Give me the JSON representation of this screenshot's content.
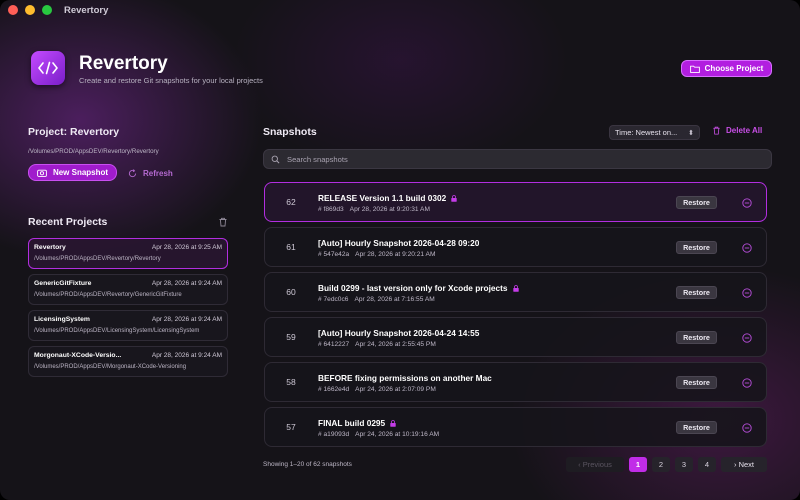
{
  "window": {
    "title": "Revertory"
  },
  "header": {
    "app_name": "Revertory",
    "subtitle": "Create and restore Git snapshots for your local projects",
    "choose_project_label": "Choose Project"
  },
  "project": {
    "title": "Project: Revertory",
    "path": "/Volumes/PROD/AppsDEV/Revertory/Revertory",
    "new_snapshot_label": "New Snapshot",
    "refresh_label": "Refresh"
  },
  "recent": {
    "title": "Recent Projects",
    "items": [
      {
        "name": "Revertory",
        "date": "Apr 28, 2026 at 9:25 AM",
        "path": "/Volumes/PROD/AppsDEV/Revertory/Revertory"
      },
      {
        "name": "GenericGitFixture",
        "date": "Apr 28, 2026 at 9:24 AM",
        "path": "/Volumes/PROD/AppsDEV/Revertory/GenericGitFixture"
      },
      {
        "name": "LicensingSystem",
        "date": "Apr 28, 2026 at 9:24 AM",
        "path": "/Volumes/PROD/AppsDEV/LicensingSystem/LicensingSystem"
      },
      {
        "name": "Morgonaut-XCode-Versio...",
        "date": "Apr 28, 2026 at 9:24 AM",
        "path": "/Volumes/PROD/AppsDEV/Morgonaut-XCode-Versioning"
      }
    ]
  },
  "snapshots": {
    "title": "Snapshots",
    "sort_label": "Time: Newest on...",
    "delete_all_label": "Delete All",
    "search_placeholder": "Search snapshots",
    "restore_label": "Restore",
    "rows": [
      {
        "num": "62",
        "title": "RELEASE Version 1.1 build 0302",
        "locked": true,
        "hash": "# f869d3",
        "date": "Apr 28, 2026 at 9:20:31 AM"
      },
      {
        "num": "61",
        "title": "[Auto] Hourly Snapshot 2026-04-28 09:20",
        "locked": false,
        "hash": "# 547e42a",
        "date": "Apr 28, 2026 at 9:20:21 AM"
      },
      {
        "num": "60",
        "title": "Build 0299 - last version only for Xcode projects",
        "locked": true,
        "hash": "# 7edc0c6",
        "date": "Apr 28, 2026 at 7:16:55 AM"
      },
      {
        "num": "59",
        "title": "[Auto] Hourly Snapshot 2026-04-24 14:55",
        "locked": false,
        "hash": "# 6412227",
        "date": "Apr 24, 2026 at 2:55:45 PM"
      },
      {
        "num": "58",
        "title": "BEFORE fixing permissions on another Mac",
        "locked": false,
        "hash": "# 1662e4d",
        "date": "Apr 24, 2026 at 2:07:09 PM"
      },
      {
        "num": "57",
        "title": "FINAL build 0295",
        "locked": true,
        "hash": "# a19093d",
        "date": "Apr 24, 2026 at 10:19:16 AM"
      }
    ],
    "footer": "Showing 1–20 of 62 snapshots"
  },
  "pagination": {
    "previous": "Previous",
    "pages": [
      "1",
      "2",
      "3",
      "4"
    ],
    "current": "1",
    "next": "Next"
  },
  "colors": {
    "accent": "#c12ce8",
    "background": "#151318"
  }
}
